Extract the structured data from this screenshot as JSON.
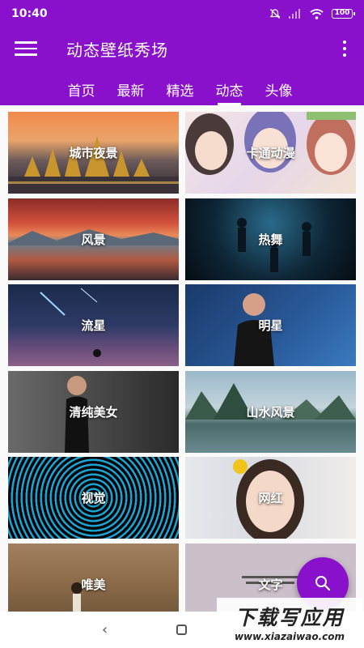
{
  "status_bar": {
    "time": "10:40",
    "battery": "100"
  },
  "app_bar": {
    "title": "动态壁纸秀场"
  },
  "tabs": [
    {
      "label": "首页",
      "active": false
    },
    {
      "label": "最新",
      "active": false
    },
    {
      "label": "精选",
      "active": false
    },
    {
      "label": "动态",
      "active": true
    },
    {
      "label": "头像",
      "active": false
    }
  ],
  "categories": [
    {
      "label": "城市夜景"
    },
    {
      "label": "卡通动漫"
    },
    {
      "label": "风景"
    },
    {
      "label": "热舞"
    },
    {
      "label": "流星"
    },
    {
      "label": "明星"
    },
    {
      "label": "清纯美女"
    },
    {
      "label": "山水风景"
    },
    {
      "label": "视觉"
    },
    {
      "label": "网红"
    },
    {
      "label": "唯美"
    },
    {
      "label": "文字"
    }
  ],
  "watermark": {
    "main": "下载写应用",
    "sub": "www.xiazaiwao.com"
  },
  "colors": {
    "primary": "#8a11cc"
  }
}
